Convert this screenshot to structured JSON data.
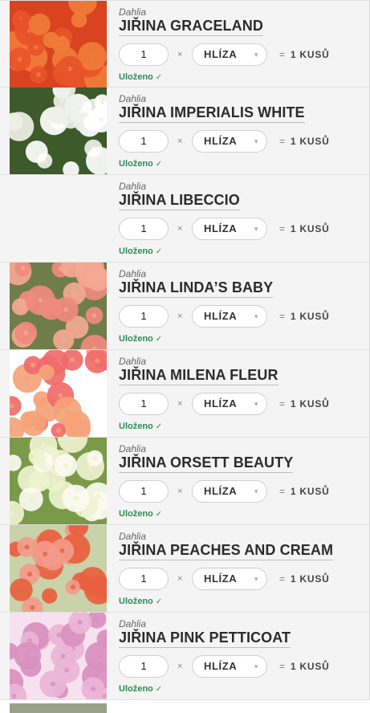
{
  "items": [
    {
      "genus": "Dahlia",
      "name": "JIŘINA GRACELAND",
      "qty": "1",
      "unit": "HLÍZA",
      "equals": "=",
      "total": "1 KUSŮ",
      "status": "Uloženo",
      "status_icon": "✓",
      "colors": [
        "#e8542a",
        "#f07c3a",
        "#d9431f"
      ],
      "has_image": true
    },
    {
      "genus": "Dahlia",
      "name": "JIŘINA IMPERIALIS WHITE",
      "qty": "1",
      "unit": "HLÍZA",
      "equals": "=",
      "total": "1 KUSŮ",
      "status": "Uloženo",
      "status_icon": "✓",
      "colors": [
        "#ffffff",
        "#eef0e8",
        "#3d5a2a"
      ],
      "has_image": true
    },
    {
      "genus": "Dahlia",
      "name": "JIŘINA LIBECCIO",
      "qty": "1",
      "unit": "HLÍZA",
      "equals": "=",
      "total": "1 KUSŮ",
      "status": "Uloženo",
      "status_icon": "✓",
      "colors": [
        "#f4f4f4",
        "#f4f4f4",
        "#f4f4f4"
      ],
      "has_image": false
    },
    {
      "genus": "Dahlia",
      "name": "JIŘINA LINDA’S BABY",
      "qty": "1",
      "unit": "HLÍZA",
      "equals": "=",
      "total": "1 KUSŮ",
      "status": "Uloženo",
      "status_icon": "✓",
      "colors": [
        "#f08a7e",
        "#f4a892",
        "#6f7d4a"
      ],
      "has_image": true
    },
    {
      "genus": "Dahlia",
      "name": "JIŘINA MILENA FLEUR",
      "qty": "1",
      "unit": "HLÍZA",
      "equals": "=",
      "total": "1 KUSŮ",
      "status": "Uloženo",
      "status_icon": "✓",
      "colors": [
        "#f06b6b",
        "#f5a37a",
        "#ffffff"
      ],
      "has_image": true
    },
    {
      "genus": "Dahlia",
      "name": "JIŘINA ORSETT BEAUTY",
      "qty": "1",
      "unit": "HLÍZA",
      "equals": "=",
      "total": "1 KUSŮ",
      "status": "Uloženo",
      "status_icon": "✓",
      "colors": [
        "#fbfbf0",
        "#eef3cf",
        "#7a9a4a"
      ],
      "has_image": true
    },
    {
      "genus": "Dahlia",
      "name": "JIŘINA PEACHES AND CREAM",
      "qty": "1",
      "unit": "HLÍZA",
      "equals": "=",
      "total": "1 KUSŮ",
      "status": "Uloženo",
      "status_icon": "✓",
      "colors": [
        "#f29a8c",
        "#e8603f",
        "#c9d2a8"
      ],
      "has_image": true
    },
    {
      "genus": "Dahlia",
      "name": "JIŘINA PINK PETTICOAT",
      "qty": "1",
      "unit": "HLÍZA",
      "equals": "=",
      "total": "1 KUSŮ",
      "status": "Uloženo",
      "status_icon": "✓",
      "colors": [
        "#eab4d6",
        "#d98fc0",
        "#f6e2ef"
      ],
      "has_image": true
    }
  ],
  "times_symbol": "×",
  "dropdown_icon": "chevron-down-icon"
}
